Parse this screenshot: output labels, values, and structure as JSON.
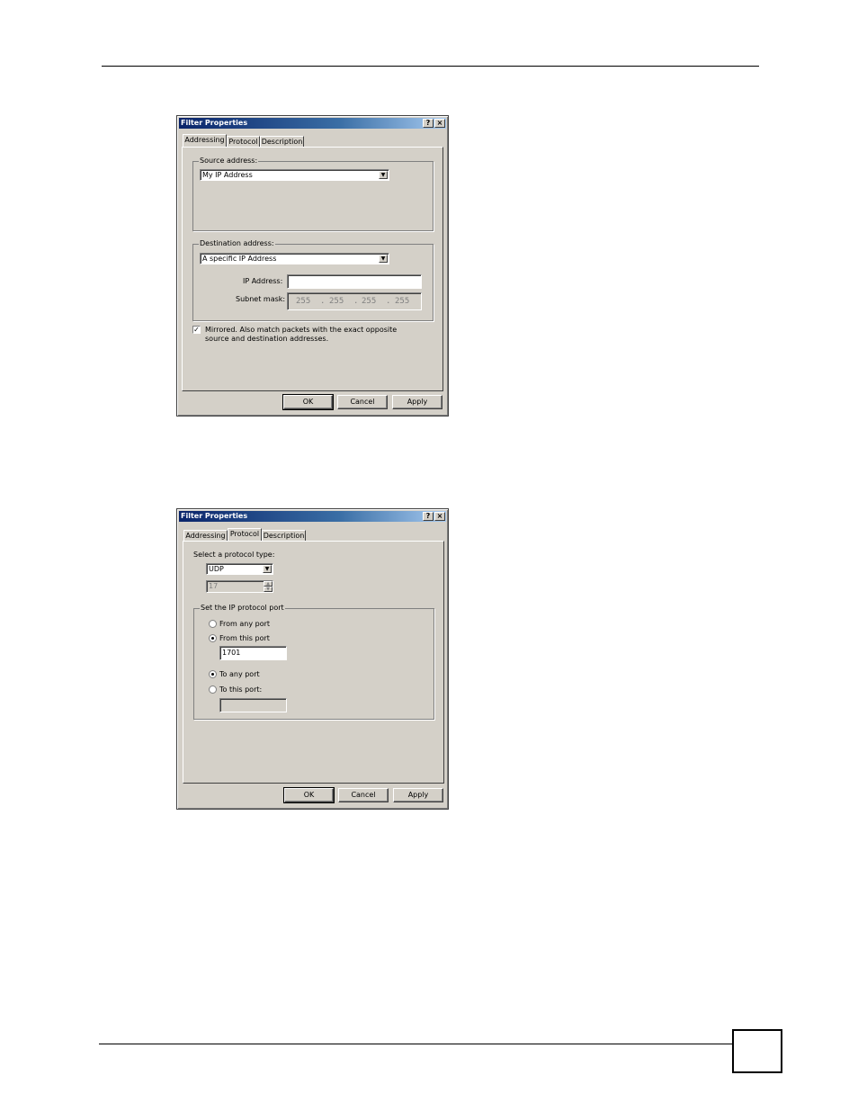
{
  "dialog1": {
    "title": "Filter Properties",
    "help": "?",
    "close": "×",
    "tabs": [
      {
        "label": "Addressing"
      },
      {
        "label": "Protocol"
      },
      {
        "label": "Description"
      }
    ],
    "source_group": "Source address:",
    "source_value": "My IP Address",
    "dest_group": "Destination address:",
    "dest_value": "A specific IP Address",
    "ip_label": "IP Address:",
    "ip_value": "",
    "mask_label": "Subnet mask:",
    "mask": [
      "255",
      ".",
      "255",
      ".",
      "255",
      ".",
      "255"
    ],
    "mirrored_text": "Mirrored. Also match packets with the exact opposite source and destination addresses.",
    "mirrored_checked": "✓",
    "ok": "OK",
    "cancel": "Cancel",
    "apply": "Apply"
  },
  "dialog2": {
    "title": "Filter Properties",
    "help": "?",
    "close": "×",
    "tabs": [
      {
        "label": "Addressing"
      },
      {
        "label": "Protocol"
      },
      {
        "label": "Description"
      }
    ],
    "protocol_label": "Select a protocol type:",
    "protocol_value": "UDP",
    "protocol_number": "17",
    "port_group": "Set the IP protocol port",
    "from_any": "From any port",
    "from_this": "From this port",
    "from_port_value": "1701",
    "to_any": "To any port",
    "to_this": "To this port:",
    "to_port_value": "",
    "ok": "OK",
    "cancel": "Cancel",
    "apply": "Apply"
  },
  "colors": {
    "titlebar": "#0a246a",
    "face": "#d4d0c8"
  }
}
